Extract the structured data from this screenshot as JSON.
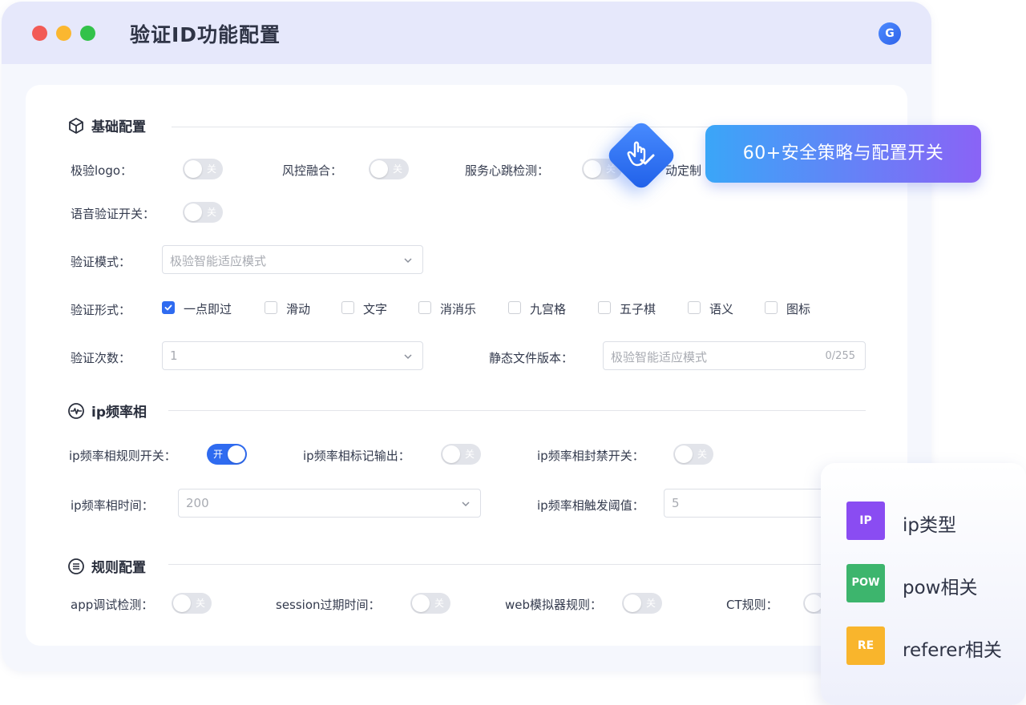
{
  "window": {
    "title": "验证ID功能配置",
    "avatar_initial": "G"
  },
  "sections": {
    "basic": "基础配置",
    "ip": "ip频率相",
    "rules": "规则配置"
  },
  "basic": {
    "logo_label": "极验logo：",
    "logo_toggle": "关",
    "risk_label": "风控融合：",
    "risk_toggle": "关",
    "heartbeat_label": "服务心跳检测：",
    "heartbeat_toggle": "关",
    "custom_label": "动定制",
    "voice_label": "语音验证开关：",
    "voice_toggle": "关",
    "mode_label": "验证模式：",
    "mode_value": "极验智能适应模式",
    "form_label": "验证形式：",
    "forms": [
      "一点即过",
      "滑动",
      "文字",
      "消消乐",
      "九宫格",
      "五子棋",
      "语义",
      "图标"
    ],
    "forms_checked": [
      true,
      false,
      false,
      false,
      false,
      false,
      false,
      false
    ],
    "count_label": "验证次数：",
    "count_value": "1",
    "static_label": "静态文件版本：",
    "static_placeholder": "极验智能适应模式",
    "static_counter": "0/255"
  },
  "ip": {
    "rule_switch_label": "ip频率相规则开关：",
    "rule_switch_toggle": "开",
    "mark_label": "ip频率相标记输出：",
    "mark_toggle": "关",
    "ban_label": "ip频率相封禁开关：",
    "ban_toggle": "关",
    "time_label": "ip频率相时间：",
    "time_value": "200",
    "threshold_label": "ip频率相触发阈值：",
    "threshold_value": "5"
  },
  "rules": {
    "app_label": "app调试检测：",
    "app_toggle": "关",
    "session_label": "session过期时间：",
    "session_toggle": "关",
    "web_label": "web模拟器规则：",
    "web_toggle": "关",
    "ct_label": "CT规则："
  },
  "banner": {
    "text": "60+安全策略与配置开关"
  },
  "side_panel": {
    "items": [
      {
        "tag": "IP",
        "label": "ip类型",
        "color": "#8a4cf2"
      },
      {
        "tag": "POW",
        "label": "pow相关",
        "color": "#3db56d"
      },
      {
        "tag": "RE",
        "label": "referer相关",
        "color": "#f9b52c"
      }
    ]
  },
  "colors": {
    "primary": "#2f6bf0",
    "title_bar": "#e6e8fb"
  }
}
